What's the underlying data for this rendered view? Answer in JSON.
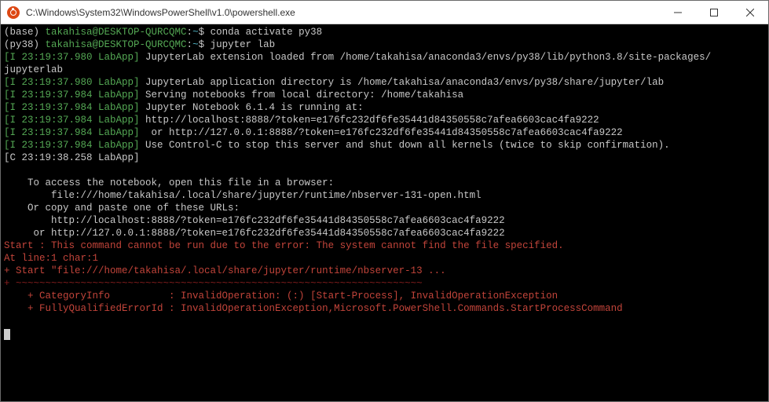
{
  "window": {
    "title": "C:\\Windows\\System32\\WindowsPowerShell\\v1.0\\powershell.exe"
  },
  "term": {
    "p1_env": "(base) ",
    "p1_userhost": "takahisa@DESKTOP-QURCQMC",
    "p1_sep": ":",
    "p1_path": "~",
    "p1_dollar": "$ ",
    "p1_cmd": "conda activate py38",
    "p2_env": "(py38) ",
    "p2_userhost": "takahisa@DESKTOP-QURCQMC",
    "p2_sep": ":",
    "p2_path": "~",
    "p2_dollar": "$ ",
    "p2_cmd": "jupyter lab",
    "l1_ts": "[I 23:19:37.980 LabApp]",
    "l1_msg": " JupyterLab extension loaded from /home/takahisa/anaconda3/envs/py38/lib/python3.8/site-packages/",
    "l1b": "jupyterlab",
    "l2_ts": "[I 23:19:37.980 LabApp]",
    "l2_msg": " JupyterLab application directory is /home/takahisa/anaconda3/envs/py38/share/jupyter/lab",
    "l3_ts": "[I 23:19:37.984 LabApp]",
    "l3_msg": " Serving notebooks from local directory: /home/takahisa",
    "l4_ts": "[I 23:19:37.984 LabApp]",
    "l4_msg": " Jupyter Notebook 6.1.4 is running at:",
    "l5_ts": "[I 23:19:37.984 LabApp]",
    "l5_msg": " http://localhost:8888/?token=e176fc232df6fe35441d84350558c7afea6603cac4fa9222",
    "l6_ts": "[I 23:19:37.984 LabApp]",
    "l6_msg": "  or http://127.0.0.1:8888/?token=e176fc232df6fe35441d84350558c7afea6603cac4fa9222",
    "l7_ts": "[I 23:19:37.984 LabApp]",
    "l7_msg": " Use Control-C to stop this server and shut down all kernels (twice to skip confirmation).",
    "l8_ts": "[C 23:19:38.258 LabApp]",
    "blank": "",
    "l9": "    To access the notebook, open this file in a browser:",
    "l10": "        file:///home/takahisa/.local/share/jupyter/runtime/nbserver-131-open.html",
    "l11": "    Or copy and paste one of these URLs:",
    "l12": "        http://localhost:8888/?token=e176fc232df6fe35441d84350558c7afea6603cac4fa9222",
    "l13": "     or http://127.0.0.1:8888/?token=e176fc232df6fe35441d84350558c7afea6603cac4fa9222",
    "e1": "Start : This command cannot be run due to the error: The system cannot find the file specified.",
    "e2": "At line:1 char:1",
    "e3": "+ Start \"file:///home/takahisa/.local/share/jupyter/runtime/nbserver-13 ...",
    "e4": "+ ~~~~~~~~~~~~~~~~~~~~~~~~~~~~~~~~~~~~~~~~~~~~~~~~~~~~~~~~~~~~~~~~~~~~~",
    "e5": "    + CategoryInfo          : InvalidOperation: (:) [Start-Process], InvalidOperationException",
    "e6": "    + FullyQualifiedErrorId : InvalidOperationException,Microsoft.PowerShell.Commands.StartProcessCommand"
  }
}
